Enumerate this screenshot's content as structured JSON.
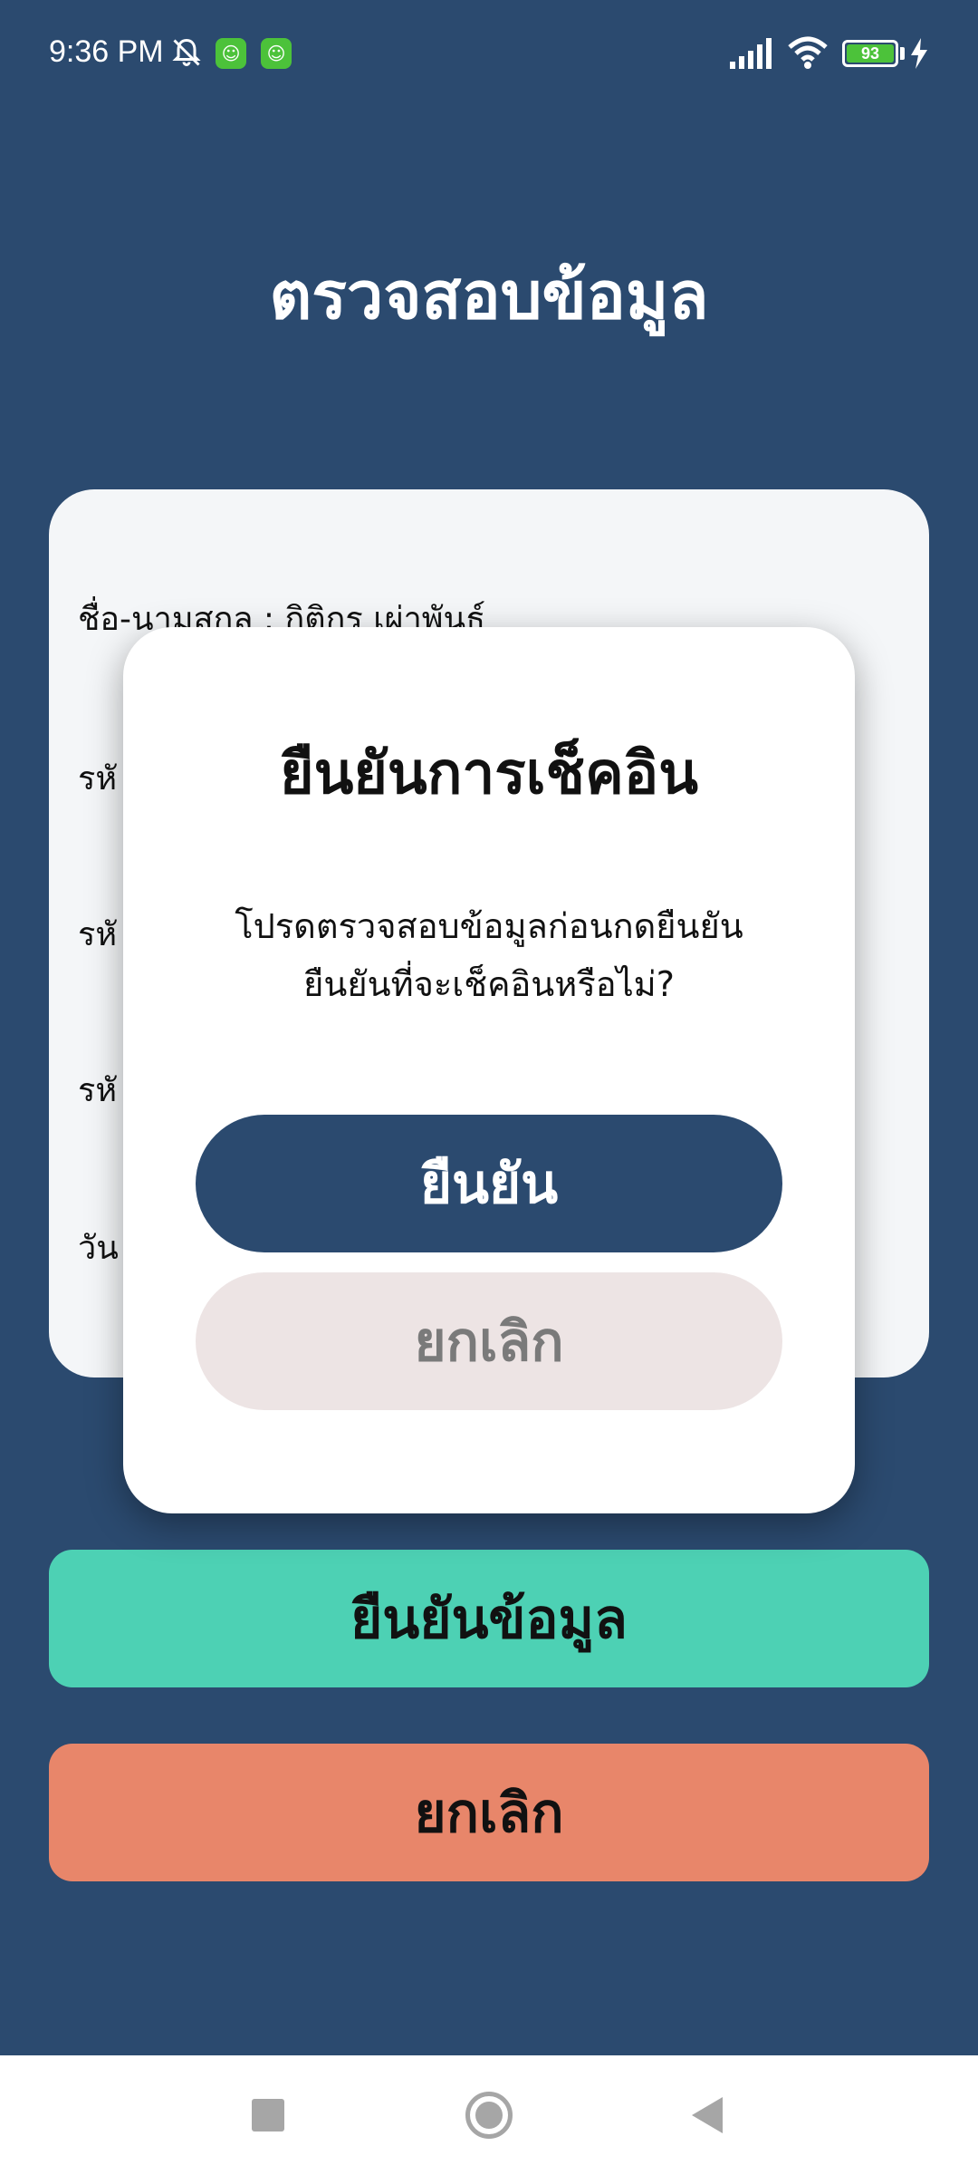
{
  "status_bar": {
    "time": "9:36 PM",
    "battery": "93",
    "icons": [
      "bell-off-icon",
      "app-icon",
      "app-icon",
      "signal-icon",
      "wifi-icon",
      "battery-icon",
      "charging-icon"
    ]
  },
  "page": {
    "title": "ตรวจสอบข้อมูล"
  },
  "info_card": {
    "rows": [
      "ชื่อ-นามสกุล : กิติกร เผ่าพันธ์",
      "รหั",
      "รหั",
      "รหั",
      "วัน"
    ]
  },
  "buttons": {
    "confirm_data": "ยืนยันข้อมูล",
    "cancel": "ยกเลิก"
  },
  "modal": {
    "title": "ยืนยันการเช็คอิน",
    "message_line1": "โปรดตรวจสอบข้อมูลก่อนกดยืนยัน",
    "message_line2": "ยืนยันที่จะเช็คอินหรือไม่?",
    "confirm": "ยืนยัน",
    "cancel": "ยกเลิก"
  },
  "colors": {
    "background": "#2b4a6f",
    "card": "#f4f6f8",
    "confirm_data_button": "#4dd1b4",
    "cancel_button": "#e8866a",
    "modal_confirm": "#2b4a6f",
    "modal_cancel": "#ede4e4"
  }
}
